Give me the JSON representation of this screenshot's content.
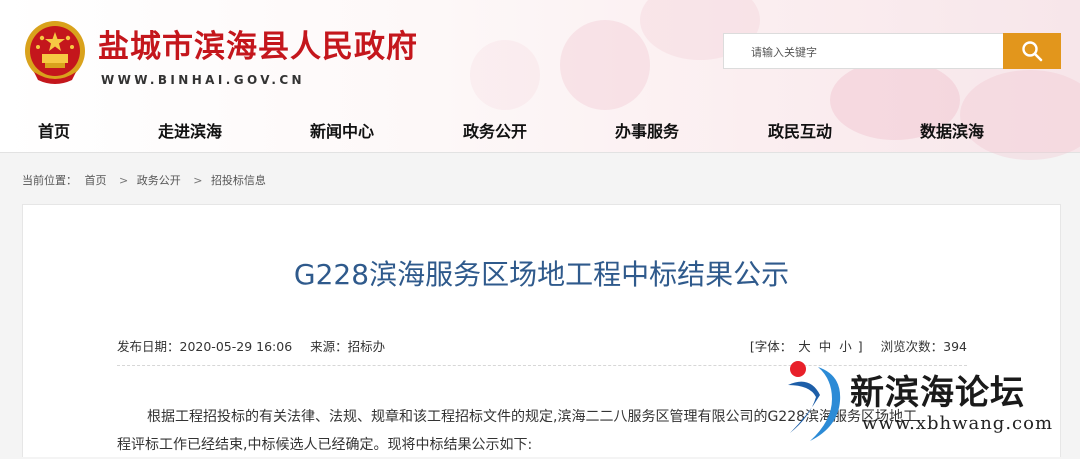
{
  "header": {
    "site_title": "盐城市滨海县人民政府",
    "site_url": "WWW.BINHAI.GOV.CN",
    "emblem_icon": "national-emblem-icon",
    "brand_color": "#c4161c"
  },
  "search": {
    "placeholder": "请输入关键字",
    "button_icon": "search-icon",
    "button_color": "#e2961c"
  },
  "nav": {
    "items": [
      {
        "label": "首页"
      },
      {
        "label": "走进滨海"
      },
      {
        "label": "新闻中心"
      },
      {
        "label": "政务公开"
      },
      {
        "label": "办事服务"
      },
      {
        "label": "政民互动"
      },
      {
        "label": "数据滨海"
      }
    ]
  },
  "breadcrumb": {
    "prefix": "当前位置：",
    "items": [
      "首页",
      "政务公开",
      "招投标信息"
    ],
    "separator": ">"
  },
  "article": {
    "title": "G228滨海服务区场地工程中标结果公示",
    "title_color": "#2f5a8c",
    "publish_label": "发布日期：2020-05-29 16:06",
    "source_label": "来源：招标办",
    "font_size_open": "[字体：",
    "font_sizes": [
      "大",
      "中",
      "小"
    ],
    "font_size_close": "]",
    "views_label": "浏览次数：394",
    "paragraph_line1": "根据工程招投标的有关法律、法规、规章和该工程招标文件的规定,滨海二二八服务区管理有限公司的G228滨海服务区场地工",
    "paragraph_line2": "程评标工作已经结束,中标候选人已经确定。现将中标结果公示如下:"
  },
  "watermark": {
    "name": "新滨海论坛",
    "url": "www.xbhwang.com",
    "logo_icon": "xbh-logo-icon"
  }
}
